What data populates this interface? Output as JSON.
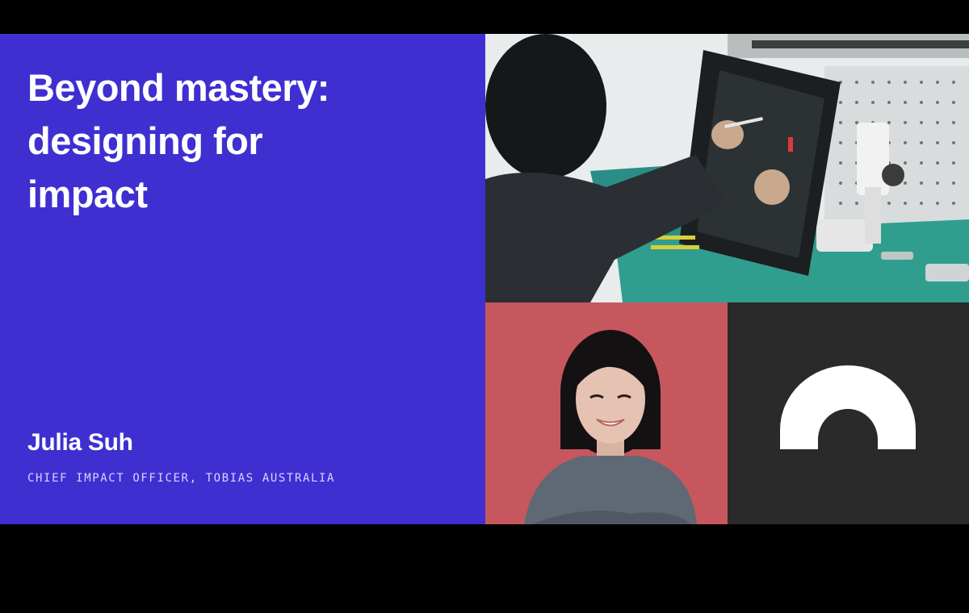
{
  "slide": {
    "title_lines": [
      "Beyond mastery:",
      "designing for",
      "impact"
    ],
    "speaker": {
      "name": "Julia Suh",
      "role": "CHIEF IMPACT OFFICER, TOBIAS AUSTRALIA"
    }
  },
  "colors": {
    "letterbox": "#000000",
    "title_panel": "#3f2fd1",
    "portrait_background": "#c7575e",
    "logo_tile": "#2a2a2a",
    "logo_mark": "#ffffff"
  },
  "icons": {
    "logo": "arch-logo-icon"
  }
}
